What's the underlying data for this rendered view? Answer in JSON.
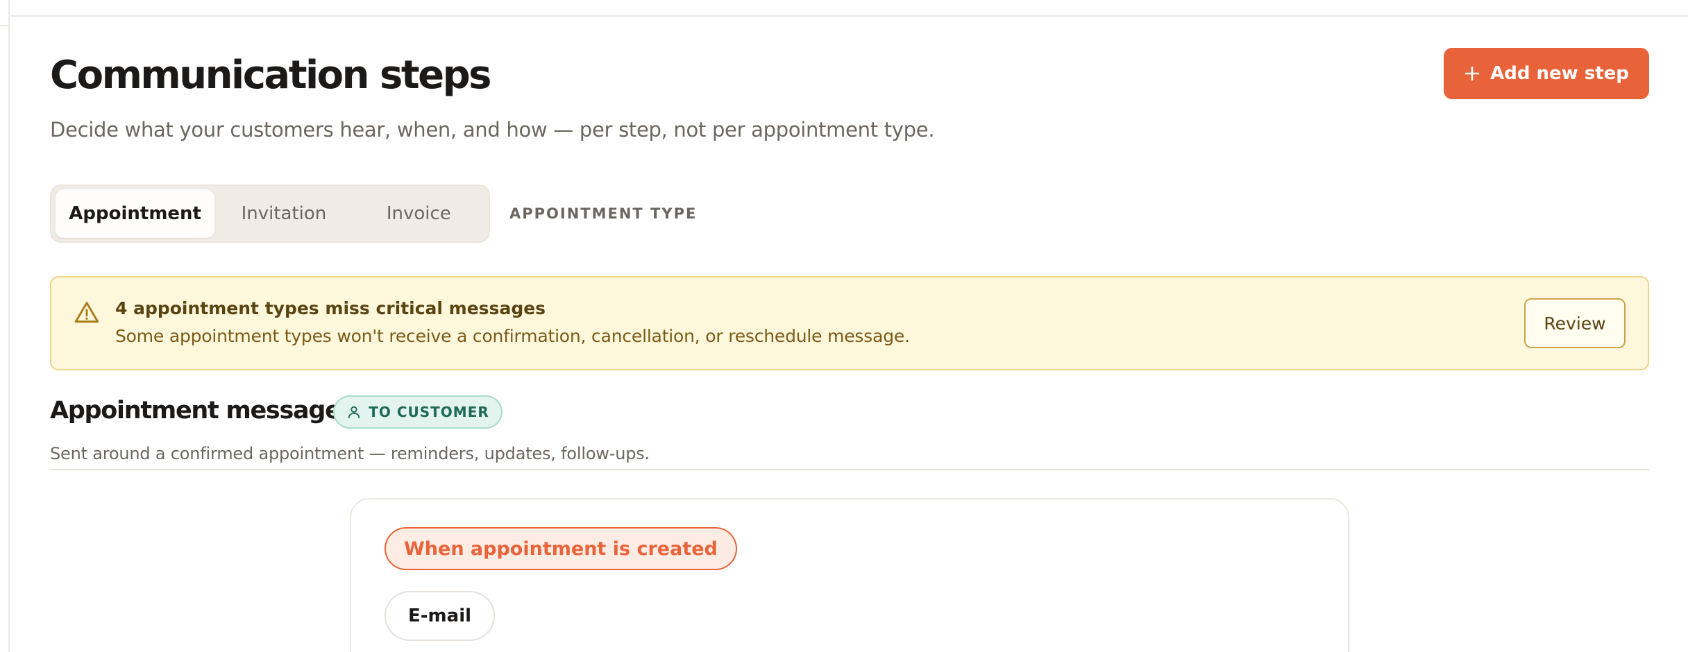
{
  "header": {
    "title": "Communication steps",
    "subtitle": "Decide what your customers hear, when, and how — per step, not per appointment type.",
    "add_button_label": "Add new step"
  },
  "tabs": {
    "items": [
      {
        "label": "Appointment",
        "active": true
      },
      {
        "label": "Invitation",
        "active": false
      },
      {
        "label": "Invoice",
        "active": false
      }
    ],
    "type_label": "APPOINTMENT TYPE"
  },
  "alert": {
    "title": "4 appointment types miss critical messages",
    "text": "Some appointment types won't receive a confirmation, cancellation, or reschedule message.",
    "button_label": "Review",
    "icon": "warning-icon"
  },
  "section": {
    "title": "Appointment messages",
    "badge": "TO CUSTOMER",
    "badge_icon": "user-icon",
    "description": "Sent around a confirmed appointment — reminders, updates, follow-ups."
  },
  "step": {
    "trigger": "When appointment is created",
    "channel": "E-mail"
  },
  "colors": {
    "accent": "#e9633a",
    "alert_bg": "#fdf7dc",
    "alert_border": "#efd58a",
    "badge_bg": "#e3f3ee",
    "badge_text": "#1d6a55"
  }
}
